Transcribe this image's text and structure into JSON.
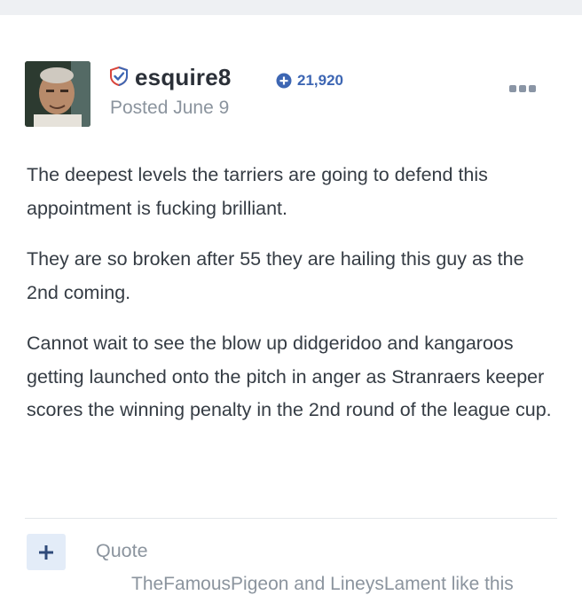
{
  "post": {
    "author": "esquire8",
    "reputation": "21,920",
    "posted": "Posted June 9",
    "paragraphs": [
      "The deepest levels the tarriers are going to defend this appointment is fucking brilliant.",
      "They are so broken after 55 they are hailing this guy as the 2nd coming.",
      "Cannot wait to see the blow up didgeridoo and kangaroos getting launched onto the pitch in anger as Stranraers keeper scores the winning penalty in the 2nd round of the league cup."
    ]
  },
  "actions": {
    "quote_label": "Quote",
    "plus_icon": "plus-icon",
    "more_icon": "ellipsis-icon"
  },
  "reactions": {
    "user1": "TheFamousPigeon",
    "conjunction": " and ",
    "user2": "LineysLament",
    "suffix": " like this"
  },
  "colors": {
    "accent": "#3d66b3",
    "muted": "#8b949e",
    "badge_red": "#d9443a",
    "text": "#353c44"
  },
  "icons": {
    "badge": "verified-shield-icon",
    "reputation": "plus-circle-icon"
  }
}
